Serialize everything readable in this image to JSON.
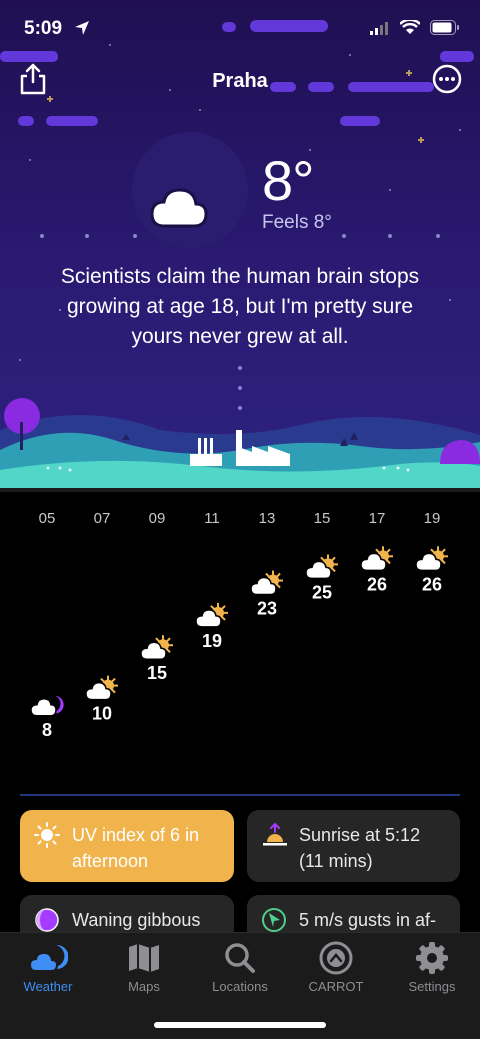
{
  "status_bar": {
    "time": "5:09"
  },
  "header": {
    "city": "Praha"
  },
  "current": {
    "temperature": "8°",
    "feels_like": "Feels 8°",
    "message": "Scientists claim the human brain stops growing at age 18, but I'm pretty sure yours never grew at all."
  },
  "hourly": {
    "hours": [
      "05",
      "07",
      "09",
      "11",
      "13",
      "15",
      "17",
      "19"
    ],
    "temps": [
      "8",
      "10",
      "15",
      "19",
      "23",
      "25",
      "26",
      "26"
    ],
    "icons": [
      "moon-cloud-icon",
      "sun-cloud-icon",
      "sun-cloud-icon",
      "sun-cloud-icon",
      "sun-cloud-icon",
      "sun-cloud-icon",
      "sun-cloud-icon",
      "sun-cloud-icon"
    ]
  },
  "chart_data": {
    "type": "scatter",
    "x": [
      "05",
      "07",
      "09",
      "11",
      "13",
      "15",
      "17",
      "19"
    ],
    "values": [
      8,
      10,
      15,
      19,
      23,
      25,
      26,
      26
    ]
  },
  "cards": {
    "uv": {
      "text": "UV index of 6 in afternoon",
      "icon": "sun-icon",
      "color": "#f1b44c"
    },
    "sunrise": {
      "text": "Sunrise at 5:12 (11 mins)",
      "icon": "sunrise-icon"
    },
    "moon": {
      "text": "Waning gibbous",
      "icon": "moon-phase-icon"
    },
    "wind": {
      "text": "5 m/s gusts in af-",
      "icon": "wind-direction-icon"
    }
  },
  "tabs": [
    {
      "label": "Weather",
      "icon": "weather-icon",
      "active": true
    },
    {
      "label": "Maps",
      "icon": "map-icon",
      "active": false
    },
    {
      "label": "Locations",
      "icon": "search-icon",
      "active": false
    },
    {
      "label": "CARROT",
      "icon": "carrot-icon",
      "active": false
    },
    {
      "label": "Settings",
      "icon": "gear-icon",
      "active": false
    }
  ],
  "colors": {
    "accent": "#3e8ef3",
    "moon": "#a53bff",
    "sky": "#2a1a72",
    "hill": "#2e9fb5"
  }
}
